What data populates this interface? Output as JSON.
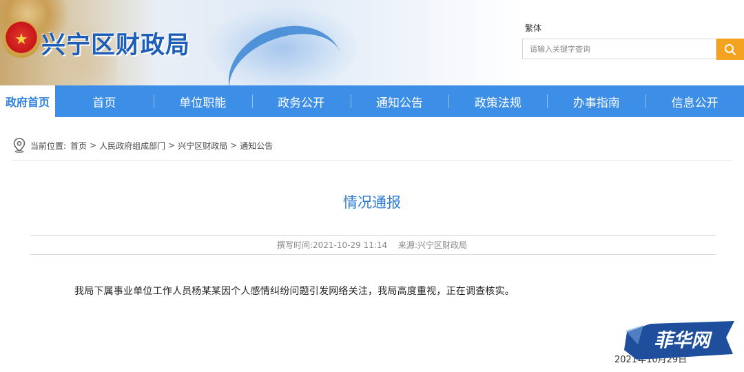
{
  "header": {
    "site_title": "兴宁区财政局",
    "traditional_link": "繁体",
    "search": {
      "placeholder": "请输入关键字查询",
      "value": ""
    }
  },
  "nav": {
    "home_label": "政府首页",
    "items": [
      "首页",
      "单位职能",
      "政务公开",
      "通知公告",
      "政策法规",
      "办事指南",
      "信息公开"
    ]
  },
  "breadcrumb": {
    "label": "当前位置:",
    "items": [
      "首页",
      "人民政府组成部门",
      "兴宁区财政局",
      "通知公告"
    ],
    "separator": ">"
  },
  "article": {
    "title": "情况通报",
    "meta_time_label": "撰写时间:",
    "meta_time": "2021-10-29 11:14",
    "meta_source_label": "来源:",
    "meta_source": "兴宁区财政局",
    "body": "我局下属事业单位工作人员杨某某因个人感情纠纷问题引发网络关注，我局高度重视，正在调查核实。",
    "date_footer": "2021年10月29日"
  },
  "watermark": {
    "text": "菲华网"
  },
  "colors": {
    "nav_bg": "#3d8ee6",
    "title_blue": "#2f7bd0",
    "search_btn": "#f4a320",
    "logo_blue": "#1d5fb8"
  },
  "icons": {
    "search": "search-icon",
    "location": "location-pin-icon",
    "emblem": "national-emblem-icon"
  }
}
